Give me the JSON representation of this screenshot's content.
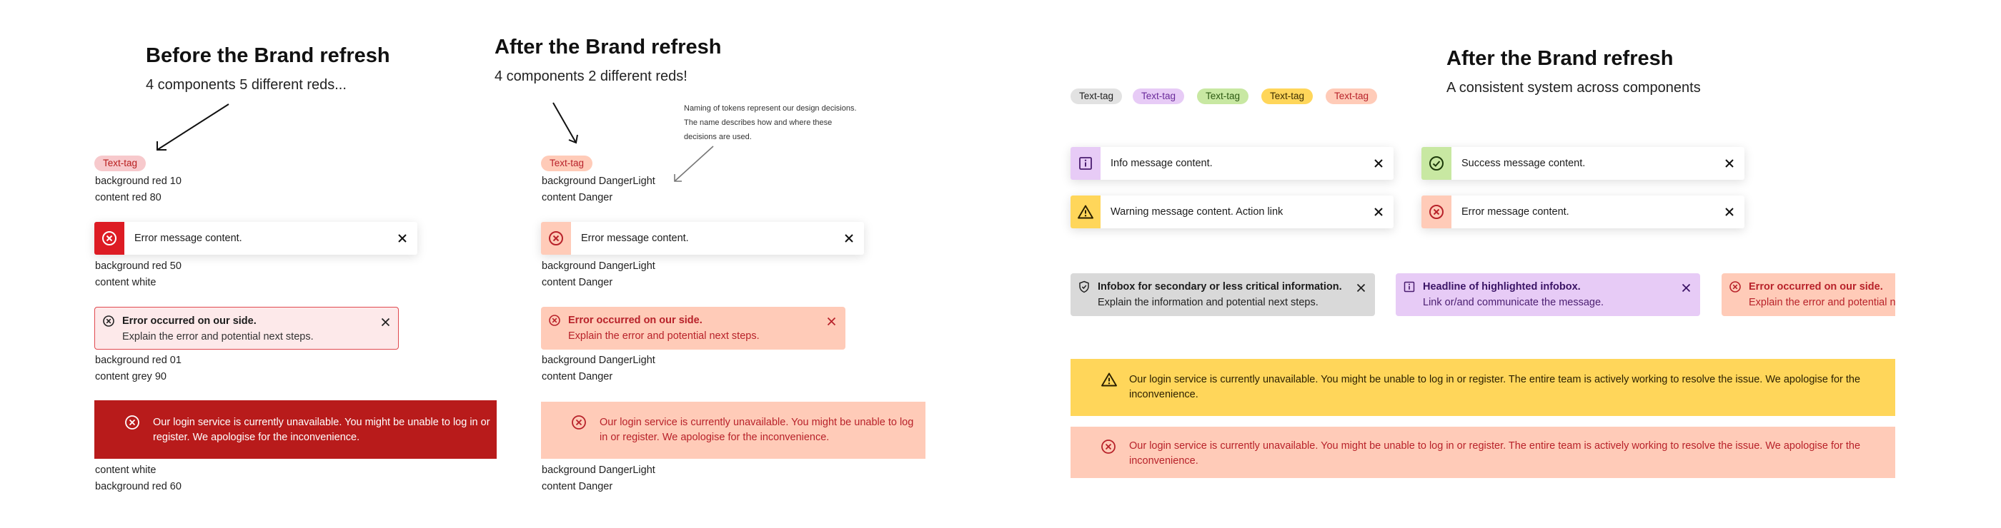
{
  "colors": {
    "red10": "#f7c9cc",
    "red80": "#b81d1d",
    "red50": "#dd1c24",
    "red01": "#fde9ea",
    "red60": "#b81b1b",
    "danger_light": "#ffcbb8",
    "danger": "#b8222a",
    "grey_tag": "#e2e2e2",
    "purple_tag": "#e7cbf6",
    "green_tag": "#c8e8a2",
    "yellow_tag": "#ffd65a",
    "info_purple": "#e7cbf6",
    "success_green": "#c8e8a2",
    "warning_yellow": "#ffd65a",
    "neutral_grey": "#d9d9d9"
  },
  "section_before": {
    "title": "Before the Brand refresh",
    "subtitle": "4 components 5 different reds...",
    "tag_label": "Text-tag",
    "tag_desc_1": "background red 10",
    "tag_desc_2": "content red 80",
    "toast_text": "Error message content.",
    "toast_desc_1": "background red 50",
    "toast_desc_2": "content white",
    "infobox_title": "Error occurred on our side.",
    "infobox_body": "Explain the error and potential next steps.",
    "infobox_desc_1": "background red 01",
    "infobox_desc_2": "content grey 90",
    "banner_line_1": "Our login service is currently unavailable. You might be unable to log in or",
    "banner_line_2": "register. We apologise for the inconvenience.",
    "banner_desc_1": "content white",
    "banner_desc_2": "background red 60"
  },
  "section_after": {
    "title": "After the Brand refresh",
    "subtitle": "4 components 2 different reds!",
    "note_1": "Naming of tokens represent our design decisions.",
    "note_2": "The name describes how and where these",
    "note_3": "decisions are used.",
    "tag_label": "Text-tag",
    "tag_desc_1": "background DangerLight",
    "tag_desc_2": "content Danger",
    "toast_text": "Error message content.",
    "toast_desc_1": "background DangerLight",
    "toast_desc_2": "content Danger",
    "infobox_title": "Error occurred on our side.",
    "infobox_body": "Explain the error and potential next steps.",
    "infobox_desc_1": "background DangerLight",
    "infobox_desc_2": "content Danger",
    "banner_line_1": "Our login service is currently unavailable. You might be unable to log",
    "banner_line_2": "in or register. We apologise for the inconvenience.",
    "banner_desc_1": "background DangerLight",
    "banner_desc_2": "content Danger"
  },
  "section_system": {
    "title": "After the Brand refresh",
    "subtitle": "A consistent system across components",
    "tags": [
      "Text-tag",
      "Text-tag",
      "Text-tag",
      "Text-tag",
      "Text-tag"
    ],
    "toast_info": "Info message content.",
    "toast_success": "Success message content.",
    "toast_warning": "Warning message content. Action link",
    "toast_error": "Error message content.",
    "infobox_neutral_title": "Infobox for secondary or less critical information.",
    "infobox_neutral_body": "Explain the information and potential next steps.",
    "infobox_highlight_title": "Headline of highlighted infobox.",
    "infobox_highlight_body": "Link or/and communicate the message.",
    "infobox_error_title": "Error occurred on our side.",
    "infobox_error_body": "Explain the error and potential next steps.",
    "banner_line_1": "Our login service is currently unavailable. You might be unable to log in or register. The entire team is actively working to resolve the issue. We apologise for the",
    "banner_line_2": "inconvenience."
  }
}
